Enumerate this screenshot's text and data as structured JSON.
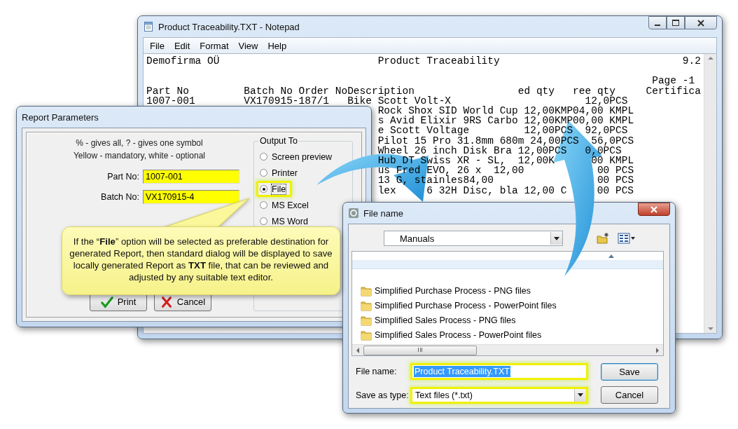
{
  "notepad": {
    "title": "Product Traceability.TXT - Notepad",
    "menu": [
      {
        "label": "File"
      },
      {
        "label": "Edit"
      },
      {
        "label": "Format"
      },
      {
        "label": "View"
      },
      {
        "label": "Help"
      }
    ],
    "lines": [
      {
        "kind": "full",
        "segments": [
          "Demofirma OÜ                          Product Traceability                              9.2"
        ]
      },
      {
        "kind": "after-blank",
        "segments": [
          "                                                                                   Page -1"
        ]
      },
      {
        "kind": "full",
        "segments": [
          "Part No         Batch No Order NoDescription                 ed qty   ree qty     Certifica"
        ]
      },
      {
        "kind": "full",
        "segments": [
          "1007-001        VX170915-187/1   Bike Scott Volt-X                      12,0PCS"
        ]
      },
      {
        "kind": "covered",
        "segments": [
          "Rock Shox SID World Cup 12,00KMP04,00 KMPL"
        ]
      },
      {
        "kind": "covered",
        "segments": [
          "s Avid Elixir 9RS Carbo 12,00KMP00,00 KMPL"
        ]
      },
      {
        "kind": "covered",
        "segments": [
          "e Scott Voltage         12,00PCS  92,0PCS"
        ]
      },
      {
        "kind": "covered",
        "segments": [
          "Pilot 15 Pro 31.8mm 680m 24,00PCS  56,0PCS"
        ]
      },
      {
        "kind": "covered",
        "segments": [
          "Wheel 26 inch Disk Bra 12,00PCS   0,0PCS"
        ]
      },
      {
        "kind": "covered",
        "segments": [
          "Hub DT Swiss XR - SL,  12,00K",
          "00 KMPL"
        ]
      },
      {
        "kind": "covered",
        "segments": [
          "us Fred EVO, 26 x  12,00",
          "00 PCS"
        ]
      },
      {
        "kind": "covered",
        "segments": [
          "13 G, stainles84,00",
          "00 PCS"
        ]
      },
      {
        "kind": "covered",
        "segments": [
          "lex",
          "6 32H Disc, bla 12,00 C",
          "00 PCS"
        ]
      }
    ]
  },
  "report_dialog": {
    "title": "Report Parameters",
    "hints": [
      "% - gives all, ? - gives one symbol",
      "Yellow - mandatory, white - optional"
    ],
    "fields": [
      {
        "label": "Part No:",
        "value": "1007-001",
        "mandatory": true
      },
      {
        "label": "Batch No:",
        "value": "VX170915-4",
        "mandatory": true
      }
    ],
    "output": {
      "legend": "Output To",
      "options": [
        {
          "label": "Screen preview",
          "selected": false,
          "highlighted": false
        },
        {
          "label": "Printer",
          "selected": false,
          "highlighted": false
        },
        {
          "label": "File",
          "selected": true,
          "highlighted": true
        },
        {
          "label": "MS Excel",
          "selected": false,
          "highlighted": false
        },
        {
          "label": "MS Word",
          "selected": false,
          "highlighted": false
        }
      ]
    },
    "buttons": [
      {
        "label": "Print",
        "kind": "confirm"
      },
      {
        "label": "Cancel",
        "kind": "cancel"
      }
    ]
  },
  "callout": {
    "text": "If the “**File**” option will be selected as preferable destination for generated Report, then standard dialog will be displayed to save locally generated Report as **TXT** file, that can be reviewed and adjusted by any suitable text editor."
  },
  "file_dialog": {
    "title": "File name",
    "location": "Manuals",
    "items": [
      "Simplified Purchase Process - PNG files",
      "Simplified Purchase Process - PowerPoint files",
      "Simplified Sales Process - PNG files",
      "Simplified Sales Process - PowerPoint files"
    ],
    "filename": {
      "label": "File name:",
      "value": "Product Traceability.TXT",
      "highlighted": true
    },
    "filetype": {
      "label": "Save as type:",
      "value": "Text files (*.txt)",
      "highlighted": true
    },
    "buttons": [
      {
        "label": "Save"
      },
      {
        "label": "Cancel"
      }
    ]
  }
}
